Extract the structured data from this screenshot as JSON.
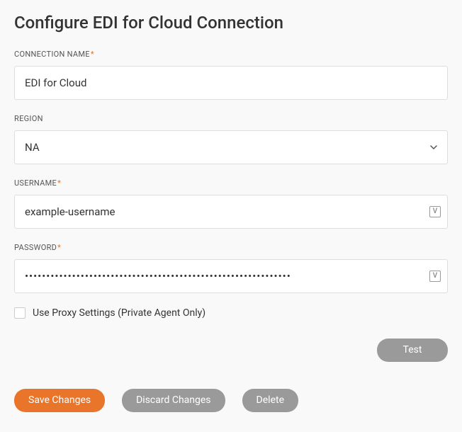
{
  "title": "Configure EDI for Cloud Connection",
  "fields": {
    "connection_name": {
      "label": "CONNECTION NAME",
      "required_mark": "*",
      "value": "EDI for Cloud"
    },
    "region": {
      "label": "REGION",
      "value": "NA"
    },
    "username": {
      "label": "USERNAME",
      "required_mark": "*",
      "value": "example-username",
      "variable_badge": "V"
    },
    "password": {
      "label": "PASSWORD",
      "required_mark": "*",
      "value": "••••••••••••••••••••••••••••••••••••••••••••••••••••••••••••••",
      "variable_badge": "V"
    },
    "use_proxy": {
      "label": "Use Proxy Settings (Private Agent Only)"
    }
  },
  "buttons": {
    "test": "Test",
    "save": "Save Changes",
    "discard": "Discard Changes",
    "delete": "Delete"
  }
}
